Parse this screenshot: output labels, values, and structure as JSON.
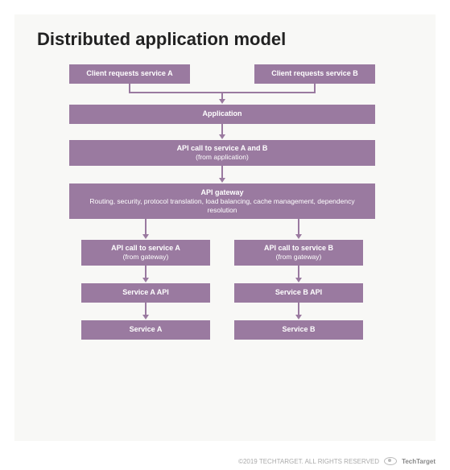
{
  "title": "Distributed application model",
  "boxes": {
    "client_a": "Client requests service A",
    "client_b": "Client requests service B",
    "application": "Application",
    "api_call_ab": "API call to service A and B",
    "api_call_ab_sub": "(from application)",
    "gateway": "API gateway",
    "gateway_sub": "Routing, security, protocol translation, load balancing, cache management, dependency resolution",
    "api_call_a": "API call to service A",
    "api_call_a_sub": "(from gateway)",
    "api_call_b": "API call to service B",
    "api_call_b_sub": "(from gateway)",
    "service_a_api": "Service A API",
    "service_b_api": "Service B API",
    "service_a": "Service A",
    "service_b": "Service B"
  },
  "attribution": "©2019 TECHTARGET. ALL RIGHTS RESERVED",
  "brand": "TechTarget",
  "colors": {
    "box": "#9a7aa0",
    "text": "#ffffff",
    "bg_outer": "#ffffff",
    "bg_inner": "#f8f8f6"
  }
}
